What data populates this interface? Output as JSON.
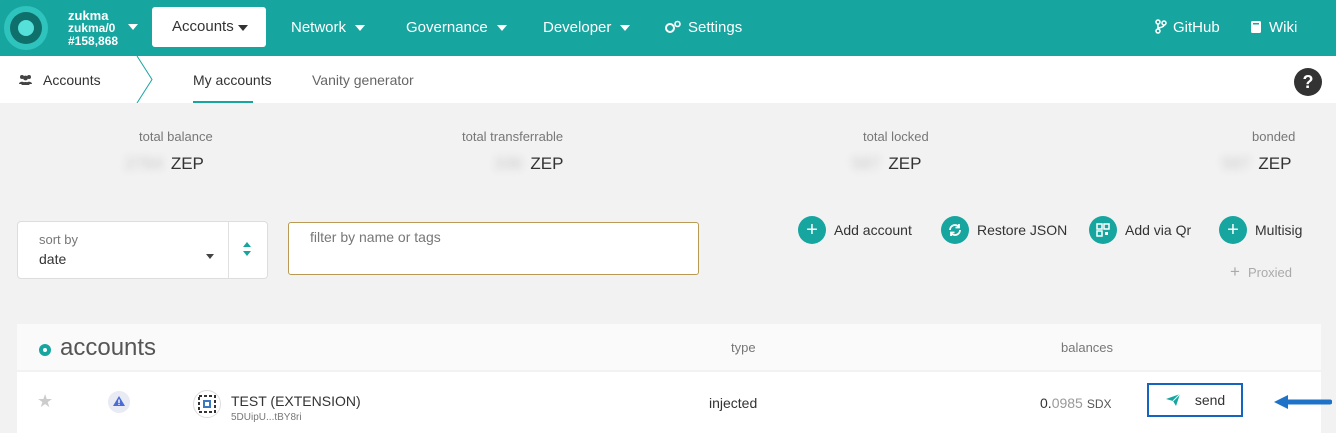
{
  "header": {
    "chain_name": "zukma",
    "chain_sub": "zukma/0",
    "block": "#158,868",
    "nav": {
      "accounts": "Accounts",
      "network": "Network",
      "governance": "Governance",
      "developer": "Developer",
      "settings": "Settings",
      "github": "GitHub",
      "wiki": "Wiki"
    }
  },
  "subnav": {
    "section": "Accounts",
    "tabs": [
      "My accounts",
      "Vanity generator"
    ],
    "help": "?"
  },
  "summary": {
    "total_balance": {
      "label": "total balance",
      "value": "2784",
      "unit": "ZEP"
    },
    "total_transferrable": {
      "label": "total transferrable",
      "value": "336",
      "unit": "ZEP"
    },
    "total_locked": {
      "label": "total locked",
      "value": "587",
      "unit": "ZEP"
    },
    "bonded": {
      "label": "bonded",
      "value": "587",
      "unit": "ZEP"
    }
  },
  "controls": {
    "sort_label": "sort by",
    "sort_value": "date",
    "filter_placeholder": "filter by name or tags",
    "buttons": {
      "add_account": "Add account",
      "restore_json": "Restore JSON",
      "add_via_qr": "Add via Qr",
      "multisig": "Multisig",
      "proxied": "Proxied"
    }
  },
  "table": {
    "title": "accounts",
    "columns": {
      "type": "type",
      "balances": "balances"
    },
    "rows": [
      {
        "name": "TEST (EXTENSION)",
        "address": "5DUipU...tBY8ri",
        "type": "injected",
        "balance_int": "0.",
        "balance_frac": "0985",
        "unit": "SDX",
        "send": "send"
      }
    ]
  },
  "colors": {
    "accent": "#17a5a0",
    "highlight": "#1565c0"
  }
}
